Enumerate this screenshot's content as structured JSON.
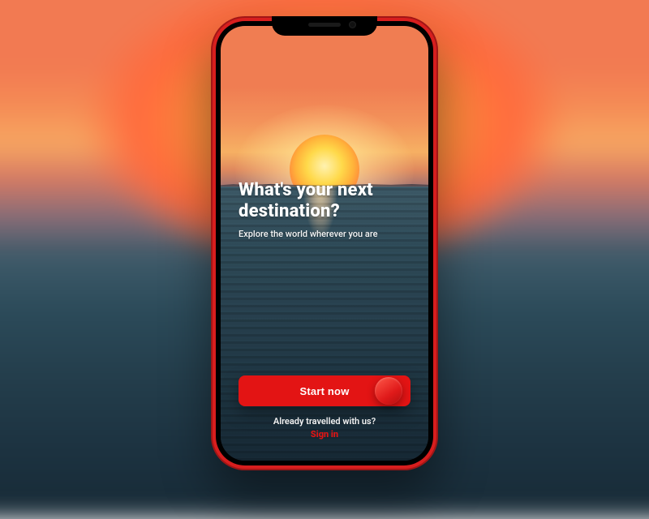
{
  "colors": {
    "accent": "#e31414",
    "frame": "#d81e1e"
  },
  "hero": {
    "title_line1": "What's your next",
    "title_line2": "destination?",
    "subtitle": "Explore the world wherever you are"
  },
  "cta": {
    "start_label": "Start now",
    "signin_prompt": "Already travelled with us?",
    "signin_label": "Sign in"
  }
}
